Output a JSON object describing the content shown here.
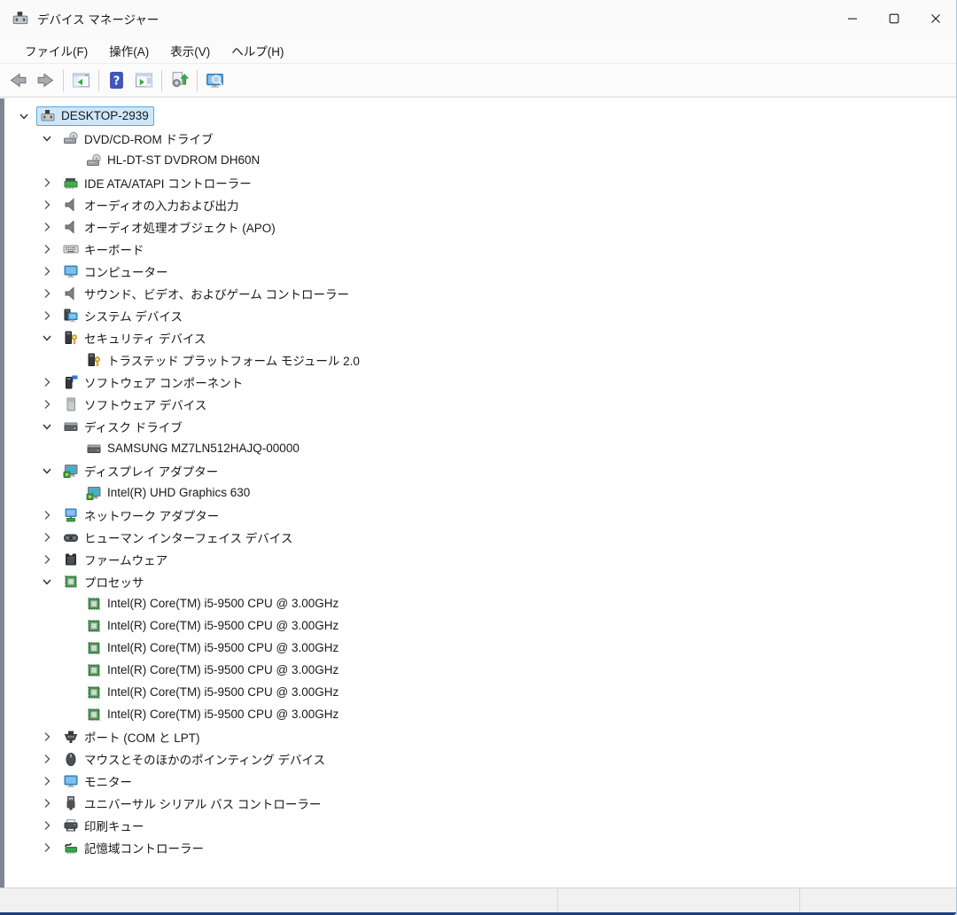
{
  "window": {
    "title": "デバイス マネージャー",
    "app_icon": "device-manager-icon",
    "controls": [
      {
        "id": "minimize",
        "icon": "minimize-icon"
      },
      {
        "id": "maximize",
        "icon": "maximize-icon"
      },
      {
        "id": "close",
        "icon": "close-icon"
      }
    ]
  },
  "menu": {
    "items": [
      {
        "id": "file",
        "label": "ファイル(F)"
      },
      {
        "id": "action",
        "label": "操作(A)"
      },
      {
        "id": "view",
        "label": "表示(V)"
      },
      {
        "id": "help",
        "label": "ヘルプ(H)"
      }
    ]
  },
  "toolbar": {
    "buttons": [
      {
        "id": "back",
        "icon": "back-icon"
      },
      {
        "id": "forward",
        "icon": "forward-icon"
      },
      {
        "id": "sep1",
        "icon": "separator"
      },
      {
        "id": "console-tree",
        "icon": "show-console-tree-icon"
      },
      {
        "id": "sep2",
        "icon": "separator"
      },
      {
        "id": "help",
        "icon": "help-icon"
      },
      {
        "id": "action-pane",
        "icon": "show-action-pane-icon"
      },
      {
        "id": "sep3",
        "icon": "separator"
      },
      {
        "id": "scan-hardware",
        "icon": "scan-hardware-changes-icon"
      },
      {
        "id": "sep4",
        "icon": "separator"
      },
      {
        "id": "device-search",
        "icon": "device-search-icon"
      }
    ]
  },
  "tree": {
    "rows": [
      {
        "level": 0,
        "state": "expanded",
        "icon": "device-manager-icon",
        "label": "DESKTOP-2939",
        "selected": true
      },
      {
        "level": 1,
        "state": "expanded",
        "icon": "dvd-drive-icon",
        "label": "DVD/CD-ROM ドライブ"
      },
      {
        "level": 2,
        "state": "none",
        "icon": "dvd-drive-icon",
        "label": "HL-DT-ST DVDROM DH60N"
      },
      {
        "level": 1,
        "state": "collapsed",
        "icon": "ide-controller-icon",
        "label": "IDE ATA/ATAPI コントローラー"
      },
      {
        "level": 1,
        "state": "collapsed",
        "icon": "audio-endpoint-icon",
        "label": "オーディオの入力および出力"
      },
      {
        "level": 1,
        "state": "collapsed",
        "icon": "audio-apo-icon",
        "label": "オーディオ処理オブジェクト (APO)"
      },
      {
        "level": 1,
        "state": "collapsed",
        "icon": "keyboard-icon",
        "label": "キーボード"
      },
      {
        "level": 1,
        "state": "collapsed",
        "icon": "computer-icon",
        "label": "コンピューター"
      },
      {
        "level": 1,
        "state": "collapsed",
        "icon": "sound-controller-icon",
        "label": "サウンド、ビデオ、およびゲーム コントローラー"
      },
      {
        "level": 1,
        "state": "collapsed",
        "icon": "system-devices-icon",
        "label": "システム デバイス"
      },
      {
        "level": 1,
        "state": "expanded",
        "icon": "security-device-icon",
        "label": "セキュリティ デバイス"
      },
      {
        "level": 2,
        "state": "none",
        "icon": "security-device-icon",
        "label": "トラステッド プラットフォーム モジュール 2.0"
      },
      {
        "level": 1,
        "state": "collapsed",
        "icon": "software-component-icon",
        "label": "ソフトウェア コンポーネント"
      },
      {
        "level": 1,
        "state": "collapsed",
        "icon": "software-device-icon",
        "label": "ソフトウェア デバイス"
      },
      {
        "level": 1,
        "state": "expanded",
        "icon": "disk-drive-icon",
        "label": "ディスク ドライブ"
      },
      {
        "level": 2,
        "state": "none",
        "icon": "disk-drive-icon",
        "label": "SAMSUNG MZ7LN512HAJQ-00000"
      },
      {
        "level": 1,
        "state": "expanded",
        "icon": "display-adapter-icon",
        "label": "ディスプレイ アダプター"
      },
      {
        "level": 2,
        "state": "none",
        "icon": "display-adapter-icon",
        "label": "Intel(R) UHD Graphics 630"
      },
      {
        "level": 1,
        "state": "collapsed",
        "icon": "network-adapter-icon",
        "label": "ネットワーク アダプター"
      },
      {
        "level": 1,
        "state": "collapsed",
        "icon": "hid-icon",
        "label": "ヒューマン インターフェイス デバイス"
      },
      {
        "level": 1,
        "state": "collapsed",
        "icon": "firmware-icon",
        "label": "ファームウェア"
      },
      {
        "level": 1,
        "state": "expanded",
        "icon": "processor-icon",
        "label": "プロセッサ"
      },
      {
        "level": 2,
        "state": "none",
        "icon": "processor-icon",
        "label": "Intel(R) Core(TM) i5-9500 CPU @ 3.00GHz"
      },
      {
        "level": 2,
        "state": "none",
        "icon": "processor-icon",
        "label": "Intel(R) Core(TM) i5-9500 CPU @ 3.00GHz"
      },
      {
        "level": 2,
        "state": "none",
        "icon": "processor-icon",
        "label": "Intel(R) Core(TM) i5-9500 CPU @ 3.00GHz"
      },
      {
        "level": 2,
        "state": "none",
        "icon": "processor-icon",
        "label": "Intel(R) Core(TM) i5-9500 CPU @ 3.00GHz"
      },
      {
        "level": 2,
        "state": "none",
        "icon": "processor-icon",
        "label": "Intel(R) Core(TM) i5-9500 CPU @ 3.00GHz"
      },
      {
        "level": 2,
        "state": "none",
        "icon": "processor-icon",
        "label": "Intel(R) Core(TM) i5-9500 CPU @ 3.00GHz"
      },
      {
        "level": 1,
        "state": "collapsed",
        "icon": "port-icon",
        "label": "ポート (COM と LPT)"
      },
      {
        "level": 1,
        "state": "collapsed",
        "icon": "mouse-icon",
        "label": "マウスとそのほかのポインティング デバイス"
      },
      {
        "level": 1,
        "state": "collapsed",
        "icon": "monitor-icon",
        "label": "モニター"
      },
      {
        "level": 1,
        "state": "collapsed",
        "icon": "usb-icon",
        "label": "ユニバーサル シリアル バス コントローラー"
      },
      {
        "level": 1,
        "state": "collapsed",
        "icon": "print-queue-icon",
        "label": "印刷キュー"
      },
      {
        "level": 1,
        "state": "collapsed",
        "icon": "storage-controller-icon",
        "label": "記憶域コントローラー"
      }
    ]
  },
  "statusbar": {
    "panes": [
      "",
      "",
      ""
    ]
  },
  "colors": {
    "selection_fill": "#cde7fa",
    "selection_border": "#5ea6dc",
    "toolbar_green": "#2fae43",
    "help_blue": "#3e57c2",
    "monitor_blue": "#46a1e2",
    "device_green": "#3aa24a",
    "key_gold": "#eebe45",
    "window_bottom_edge": "#1f3f7e",
    "left_frame_gray": "#7e8791"
  }
}
